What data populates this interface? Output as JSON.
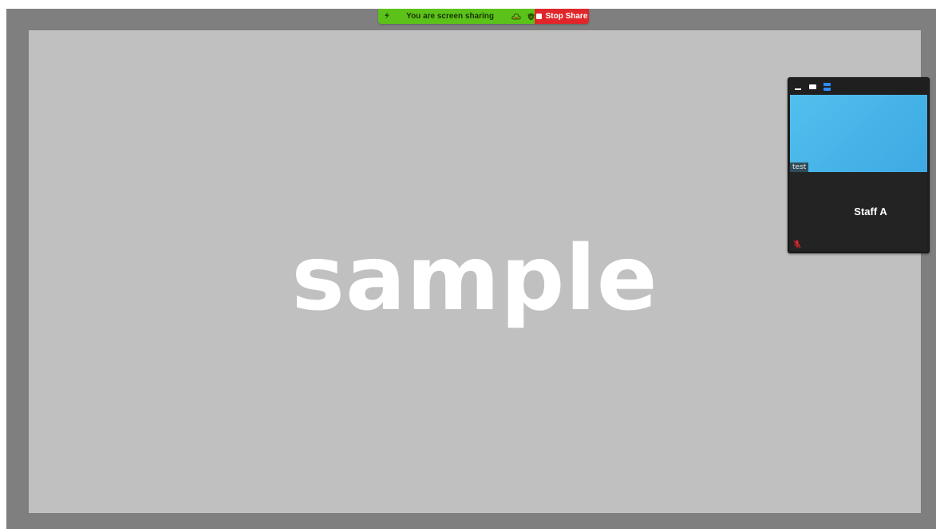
{
  "share_bar": {
    "status_text": "You are screen sharing",
    "stop_label": "Stop Share",
    "accent_green": "#5cc21a",
    "accent_red": "#e0262a",
    "icons": [
      "bolt-icon",
      "cloud-icon",
      "shield-icon",
      "stop-square-icon"
    ]
  },
  "shared_screen": {
    "watermark_text": "sample"
  },
  "video_panel": {
    "header_buttons": [
      "minimize-icon",
      "single-view-icon",
      "stacked-view-icon"
    ],
    "video_tile_label": "test",
    "participant_name": "Staff A",
    "mic_status": "muted"
  }
}
